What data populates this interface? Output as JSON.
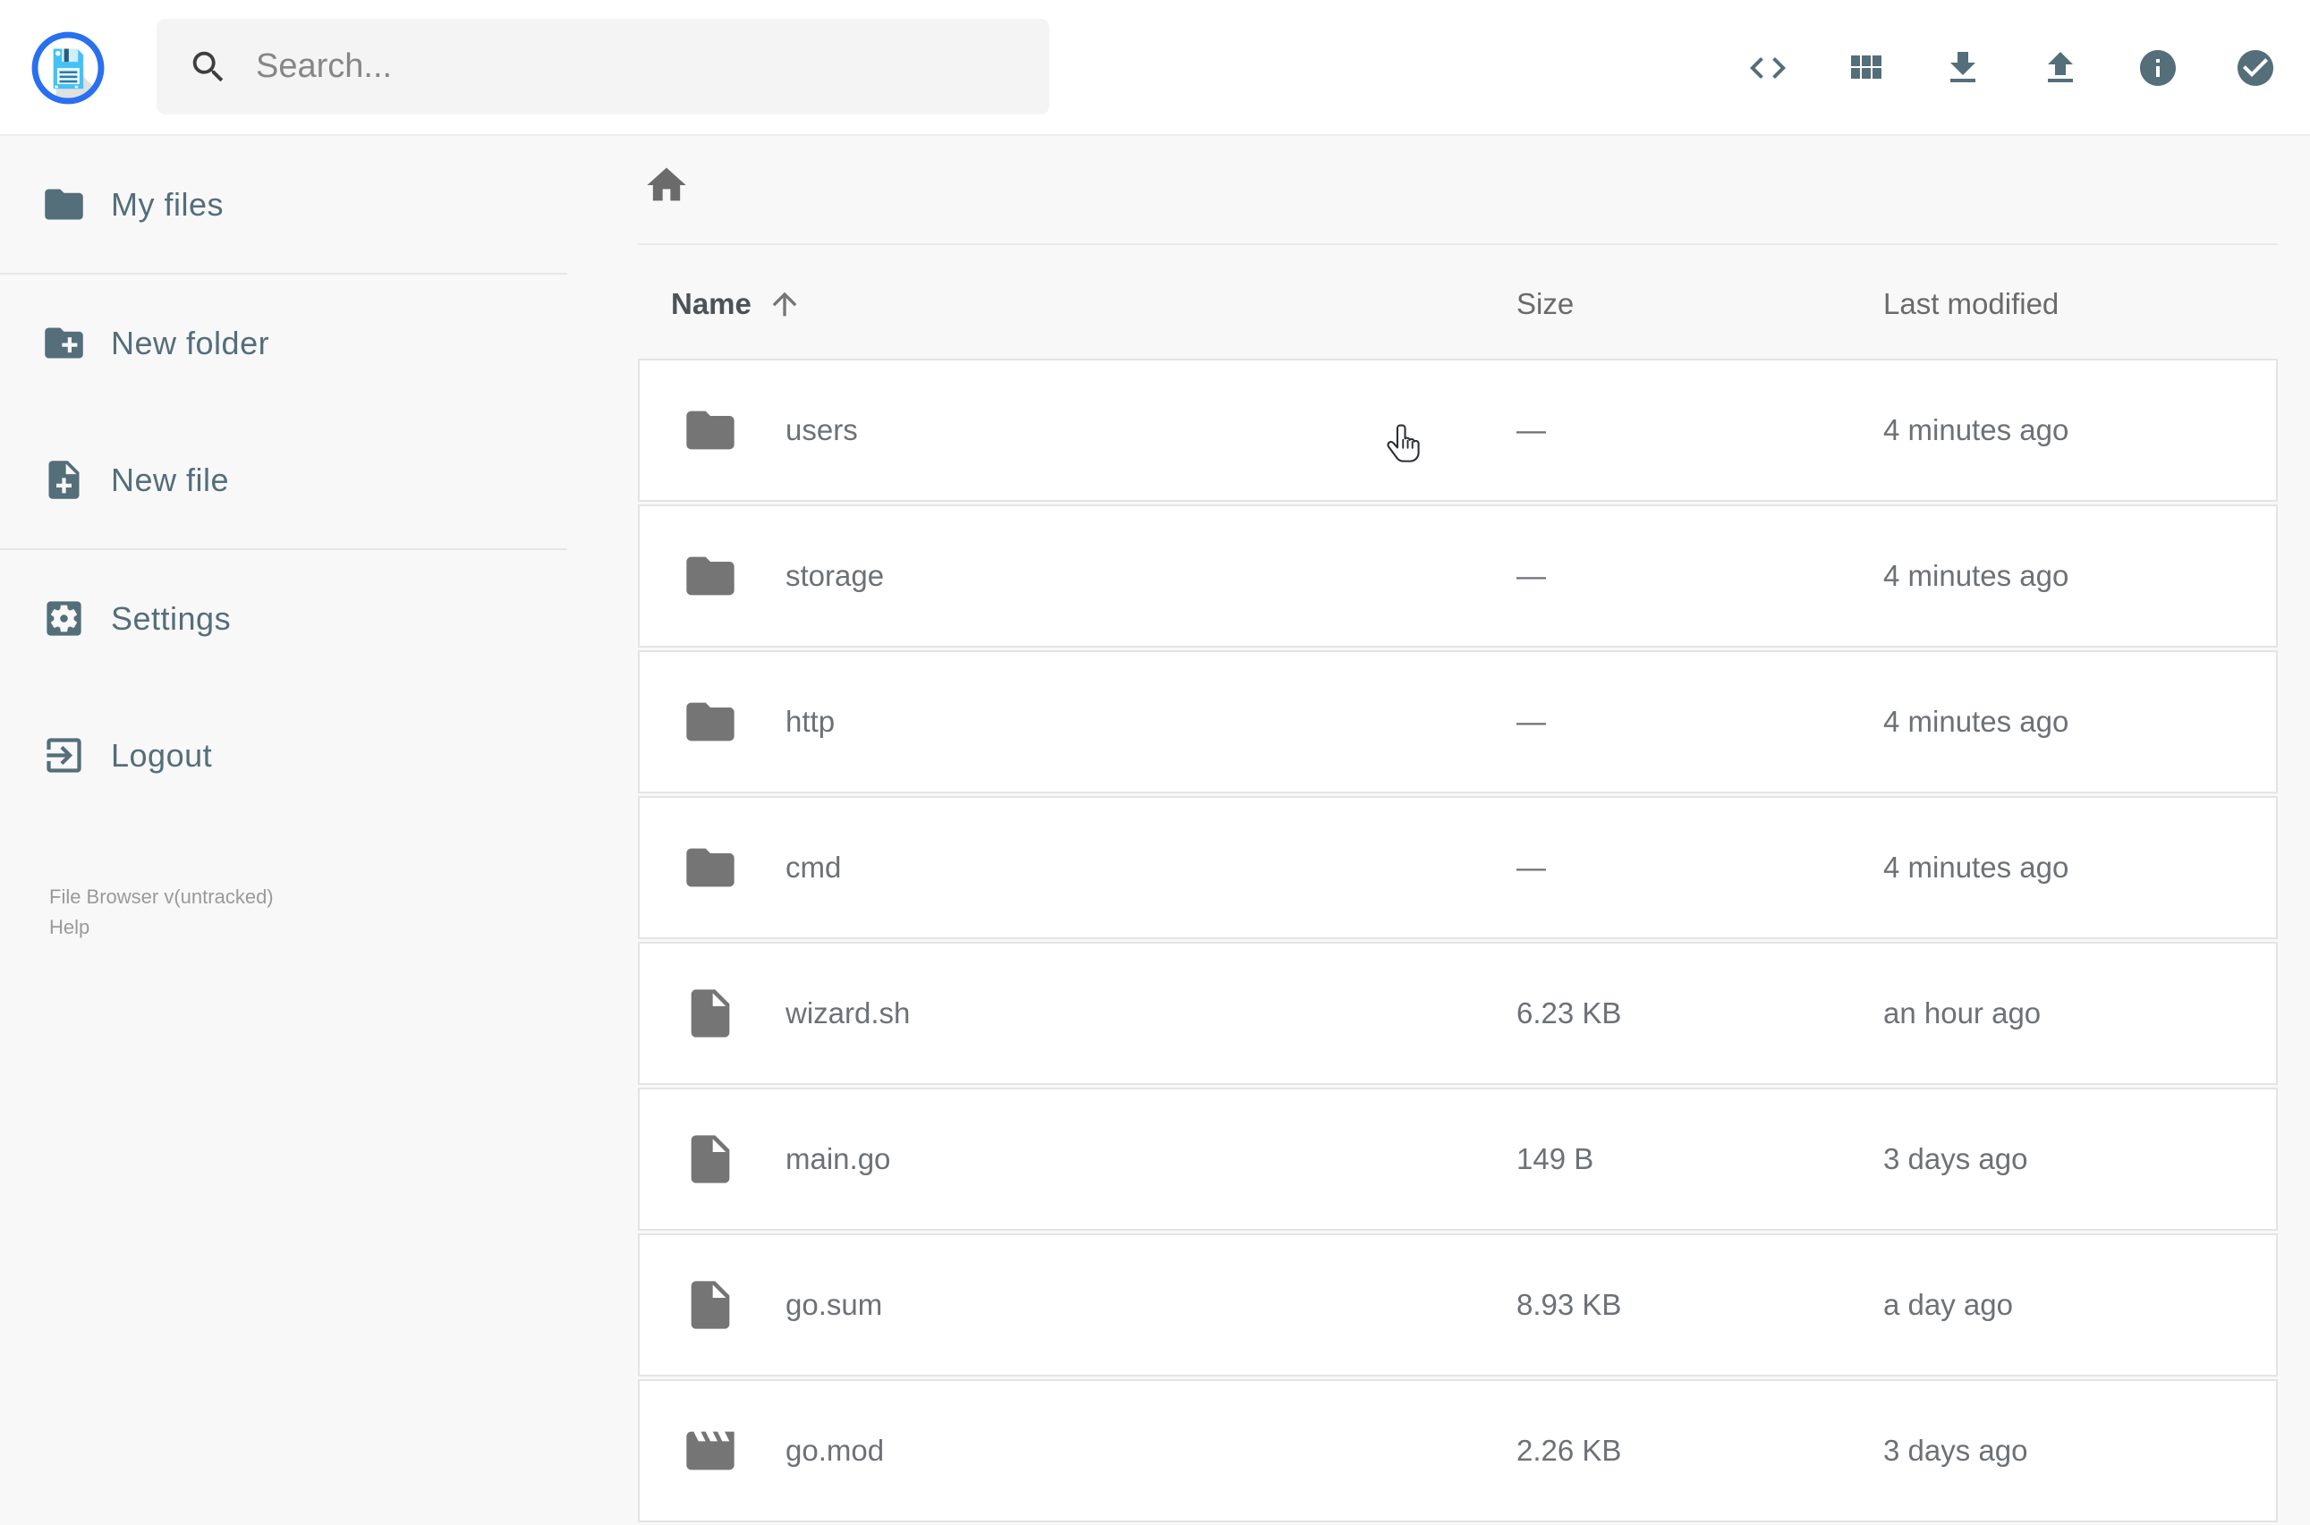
{
  "header": {
    "logo_icon": "floppy-disk-logo-icon",
    "search": {
      "placeholder": "Search..."
    },
    "actions": [
      {
        "id": "open-shell",
        "icon": "code-icon"
      },
      {
        "id": "switch-view",
        "icon": "grid-view-icon"
      },
      {
        "id": "download",
        "icon": "download-icon"
      },
      {
        "id": "upload",
        "icon": "upload-icon"
      },
      {
        "id": "info",
        "icon": "info-icon"
      },
      {
        "id": "select-multiple",
        "icon": "check-circle-icon"
      }
    ]
  },
  "sidebar": {
    "items": [
      {
        "label": "My files",
        "icon": "folder-icon",
        "divider_after": true
      },
      {
        "label": "New folder",
        "icon": "folder-plus-icon",
        "divider_after": false
      },
      {
        "label": "New file",
        "icon": "file-plus-icon",
        "divider_after": true
      },
      {
        "label": "Settings",
        "icon": "gear-icon",
        "divider_after": false
      },
      {
        "label": "Logout",
        "icon": "logout-icon",
        "divider_after": false
      }
    ],
    "footer": {
      "version": "File Browser v(untracked)",
      "help": "Help"
    }
  },
  "main": {
    "breadcrumb": {
      "home_icon": "home-icon"
    },
    "listing": {
      "columns": {
        "name": "Name",
        "size": "Size",
        "modified": "Last modified"
      },
      "sort": {
        "column": "Name",
        "direction": "ascending",
        "icon": "arrow-up-icon"
      },
      "items": [
        {
          "name": "users",
          "icon": "folder-icon",
          "size": "—",
          "modified": "4 minutes ago"
        },
        {
          "name": "storage",
          "icon": "folder-icon",
          "size": "—",
          "modified": "4 minutes ago"
        },
        {
          "name": "http",
          "icon": "folder-icon",
          "size": "—",
          "modified": "4 minutes ago"
        },
        {
          "name": "cmd",
          "icon": "folder-icon",
          "size": "—",
          "modified": "4 minutes ago"
        },
        {
          "name": "wizard.sh",
          "icon": "file-icon",
          "size": "6.23 KB",
          "modified": "an hour ago"
        },
        {
          "name": "main.go",
          "icon": "file-icon",
          "size": "149 B",
          "modified": "3 days ago"
        },
        {
          "name": "go.sum",
          "icon": "file-icon",
          "size": "8.93 KB",
          "modified": "a day ago"
        },
        {
          "name": "go.mod",
          "icon": "movie-file-icon",
          "size": "2.26 KB",
          "modified": "3 days ago"
        }
      ]
    }
  },
  "cursor": {
    "icon": "pointer-hand-cursor"
  },
  "colors": {
    "accent_blue": "#2870f0",
    "slate_icon": "#546e7a",
    "row_text": "#6d7175",
    "background": "#f8f8f8",
    "floppy_cyan": "#45c1f5"
  }
}
